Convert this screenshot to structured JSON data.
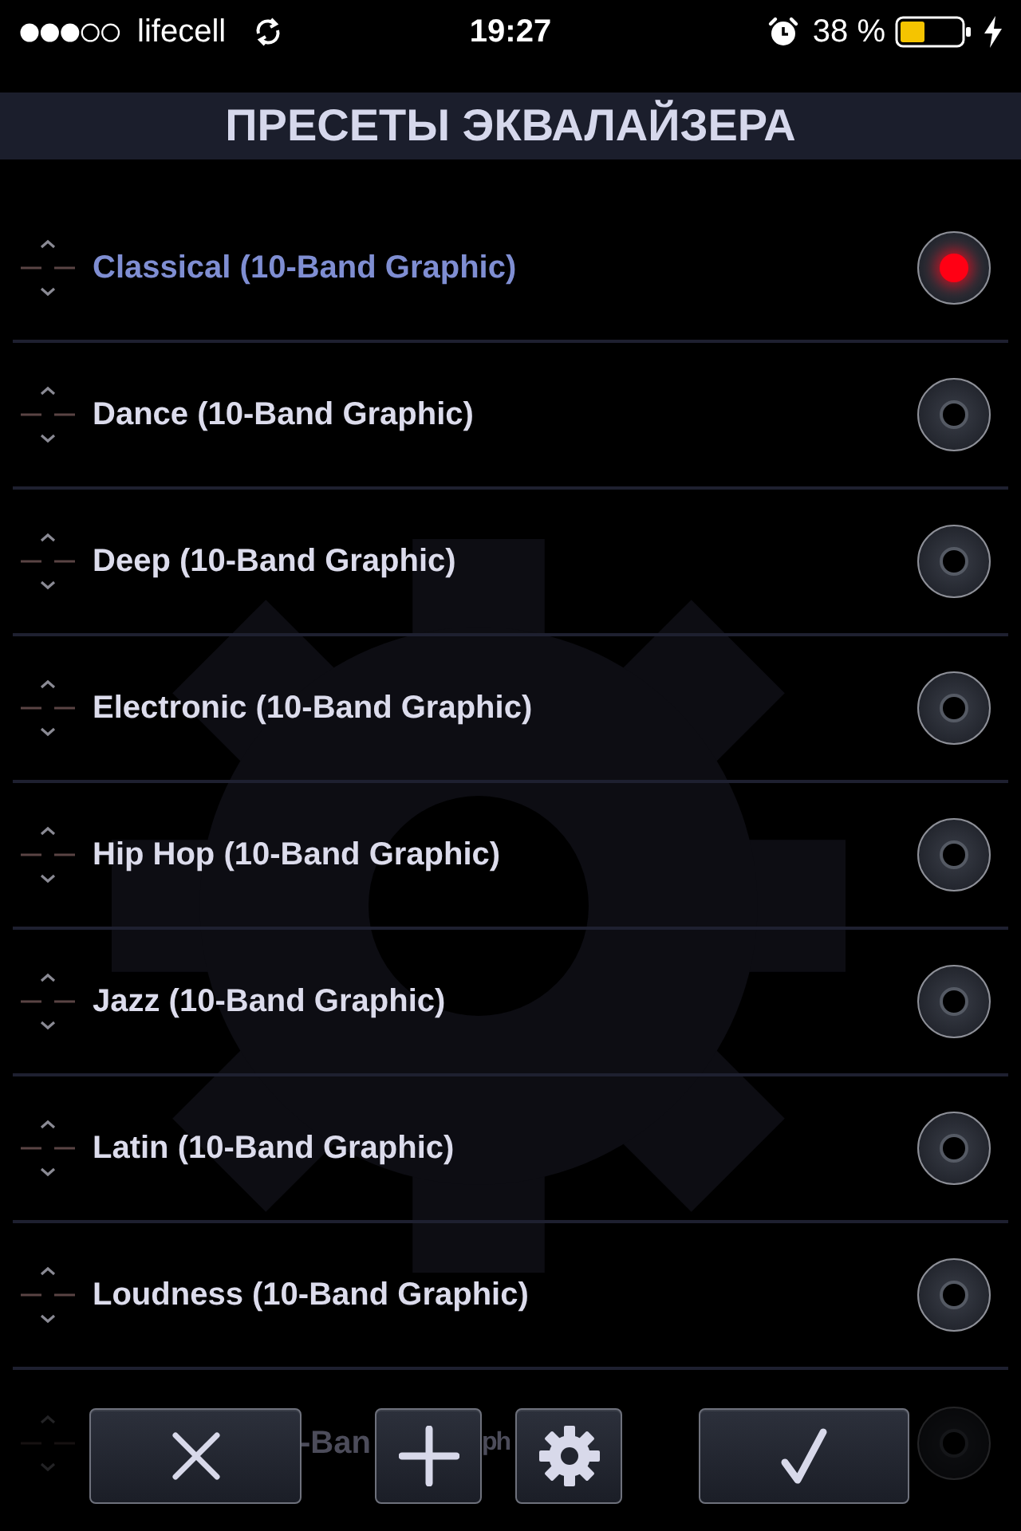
{
  "status_bar": {
    "carrier": "lifecell",
    "time": "19:27",
    "battery_percent": "38 %"
  },
  "title": "ПРЕСЕТЫ ЭКВАЛАЙЗЕРА",
  "presets": [
    {
      "name": "Classical (10-Band Graphic)",
      "selected": true
    },
    {
      "name": "Dance (10-Band Graphic)",
      "selected": false
    },
    {
      "name": "Deep (10-Band Graphic)",
      "selected": false
    },
    {
      "name": "Electronic (10-Band Graphic)",
      "selected": false
    },
    {
      "name": "Hip Hop (10-Band Graphic)",
      "selected": false
    },
    {
      "name": "Jazz (10-Band Graphic)",
      "selected": false
    },
    {
      "name": "Latin (10-Band Graphic)",
      "selected": false
    },
    {
      "name": "Loudness (10-Band Graphic)",
      "selected": false
    }
  ],
  "partial_row": {
    "visible_text": [
      "-Ban",
      "ph"
    ],
    "selected": false
  }
}
